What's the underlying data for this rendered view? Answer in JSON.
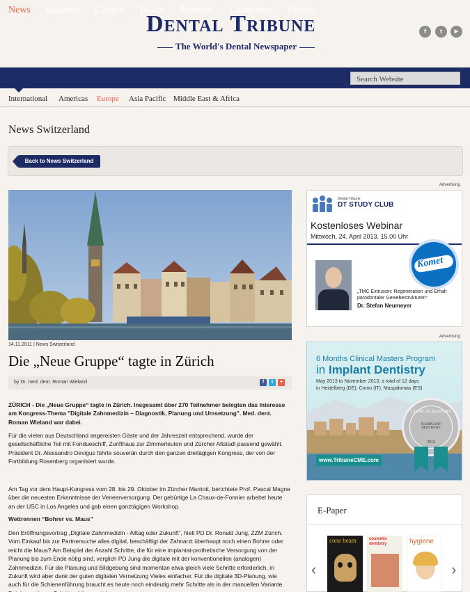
{
  "brand": {
    "title": "Dental Tribune",
    "tagline": "The World's Dental Newspaper",
    "social": [
      "f",
      "t",
      "▶"
    ]
  },
  "nav": {
    "items": [
      "News",
      "Business",
      "Clinical",
      "Topics",
      "Products",
      "Companies",
      "Events"
    ],
    "active": "News",
    "search_placeholder": "Search Website"
  },
  "subnav": {
    "items": [
      "International",
      "Americas",
      "Europe",
      "Asia Pacific",
      "Middle East & Africa"
    ],
    "active": "Europe"
  },
  "section_title": "News Switzerland",
  "back_button": "Back to News Switzerland",
  "article": {
    "meta": "14.11.2011 | News Switzerland",
    "headline": "Die „Neue Gruppe“ tagte in Zürich",
    "byline": "by Dr. med. dent. Roman Wieland",
    "lead": "ZÜRICH - Die „Neue Gruppe“ tagte in Zürich. Insgesamt über 270 Teilnehmer belegten das Interesse am Kongress-Thema \"Digitale Zahnmedizin – Diagnostik, Planung und Umsetzung\". Med. dent. Roman Wieland war dabei.",
    "p1": "Für die vielen aus Deutschland angereisten Gäste und der Jahreszeit entsprechend, wurde der gesellschaftliche Teil mit Fondueschiff, Zunfthaus zur Zimmerleuten und Zürcher Altstadt passend gewählt. Präsident Dr. Alessandro Devigus führte souverän durch den ganzen dreitägigen Kongress, der von der Fortbildung Rosenberg organisiert wurde.",
    "p2": "Am Tag vor dem Haupt-Kongress vom 28. bis 29. Oktober im Zürcher Marriott, berichtete Prof. Pascal Magne über die neuesten Erkenntnisse der Veneerversorgung. Der gebürtige La Chaux-de-Fonnier arbeitet heute an der USC in Los Angeles und gab einen ganztägigen Workshop.",
    "subhead": "Wettrennen “Bohrer vs. Maus”",
    "p3": "Den Eröffnungsvortrag „Digitale Zahnmedizin - Alltag oder Zukunft“, hielt PD Dr. Ronald Jung, ZZM Zürich. Vom Einkauf bis zur Partnersuche alles digital, beschäftigt der Zahnarzt überhaupt noch einen Bohrer oder reicht die Maus? Am Beispiel der Anzahl Schritte, die für eine implantat-prothetische Versorgung von der Planung bis zum Ende nötig sind, verglich PD Jung die digitale mit der konventionellen (analogen) Zahnmedizin. Für die Planung und Bildgebung sind momentan etwa gleich viele Schritte erforderlich, in Zukunft wird aber dank der guten digitalen Vernetzung Vieles einfacher. Für die digitale 3D-Planung, wie auch für die Schienenführung braucht es heute noch eindeutig mehr Schritte als in der manuellen Variante. Bei den weiteren Schritten können sich"
  },
  "ads": {
    "label": "Advertising",
    "ad1": {
      "brand_small": "Dental Tribune",
      "brand": "DT STUDY CLUB",
      "title": "Kostenloses Webinar",
      "date": "Mittwoch, 24. April 2013, 15.00 Uhr",
      "logo": "Komet",
      "topic": "„TMC Extrusion: Regeneration und Erhalt parodontaler Gewebestrukturen“",
      "speaker": "Dr. Stefan Neumeyer"
    },
    "ad2": {
      "line1": "6 Months Clinical Masters Program",
      "line2a": "in ",
      "line2b": "Implant Dentistry",
      "dates": "May 2013 to November 2013, a total of 12 days",
      "places": "in Heidelberg (DE), Como (IT), Maspalomas (ES)",
      "seal_top": "CLINICAL MASTERS",
      "seal_mid": "IN IMPLANT DENTISTRY",
      "seal_year": "2013",
      "url": "www.TribuneCME.com"
    }
  },
  "epaper": {
    "title": "E-Paper",
    "covers": [
      "cone beam",
      "cosmetic dentistry",
      "hygiene"
    ]
  }
}
